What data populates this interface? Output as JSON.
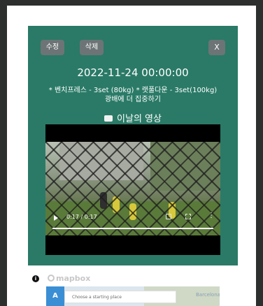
{
  "modal": {
    "buttons": {
      "edit_label": "수정",
      "delete_label": "삭제",
      "close_label": "X"
    },
    "date": "2022-11-24 00:00:00",
    "workout": "* 벤치프레스 - 3set (80kg) * 랫풀다운 - 3set(100kg)",
    "memo": "광배에 더 집중하기",
    "video_section_title": "이날의 영상",
    "video": {
      "time": "0:17 / 0:17",
      "more_glyph": "⋮"
    }
  },
  "map": {
    "info_glyph": "i",
    "logo_text": "mapbox",
    "start_marker": "A",
    "start_placeholder": "Choose a starting place",
    "place_label": "Barcelona"
  },
  "colors": {
    "card_bg": "#2a7a67",
    "button_bg": "#6d7476",
    "map_accent": "#3a8fd4"
  }
}
